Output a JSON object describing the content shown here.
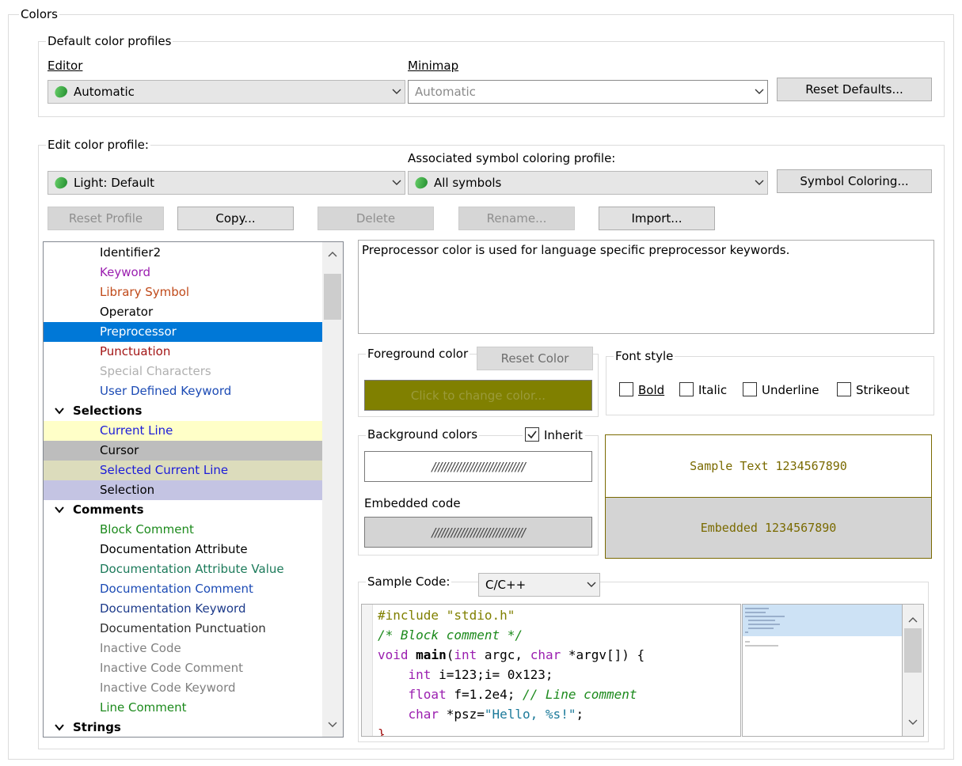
{
  "colors_group": {
    "title": "Colors"
  },
  "default_profiles": {
    "title": "Default color profiles",
    "editor_label": "Editor",
    "editor_value": "Automatic",
    "minimap_label": "Minimap",
    "minimap_value": "Automatic",
    "reset_defaults": "Reset Defaults..."
  },
  "edit_profile": {
    "title": "Edit color profile:",
    "profile_value": "Light: Default",
    "assoc_label": "Associated symbol coloring profile:",
    "assoc_value": "All symbols",
    "symbol_coloring": "Symbol Coloring...",
    "buttons": {
      "reset_profile": "Reset Profile",
      "copy": "Copy...",
      "delete": "Delete",
      "rename": "Rename...",
      "import": "Import..."
    }
  },
  "element_list": [
    {
      "label": "Identifier2",
      "color": "#000000",
      "bg": "",
      "kind": "item"
    },
    {
      "label": "Keyword",
      "color": "#9b1fb0",
      "bg": "",
      "kind": "item"
    },
    {
      "label": "Library Symbol",
      "color": "#c04a1a",
      "bg": "",
      "kind": "item"
    },
    {
      "label": "Operator",
      "color": "#000000",
      "bg": "",
      "kind": "item"
    },
    {
      "label": "Preprocessor",
      "color": "#ffffff",
      "bg": "#0078d7",
      "kind": "item"
    },
    {
      "label": "Punctuation",
      "color": "#a31515",
      "bg": "",
      "kind": "item"
    },
    {
      "label": "Special Characters",
      "color": "#b0b0b0",
      "bg": "",
      "kind": "item"
    },
    {
      "label": "User Defined Keyword",
      "color": "#1c4bb5",
      "bg": "",
      "kind": "item"
    },
    {
      "label": "Selections",
      "color": "#000000",
      "bg": "",
      "kind": "category"
    },
    {
      "label": "Current Line",
      "color": "#1c1cd9",
      "bg": "#ffffc8",
      "kind": "item"
    },
    {
      "label": "Cursor",
      "color": "#000000",
      "bg": "#bdbdbd",
      "kind": "item"
    },
    {
      "label": "Selected Current Line",
      "color": "#1c1cd9",
      "bg": "#dcdcbc",
      "kind": "item"
    },
    {
      "label": "Selection",
      "color": "#000000",
      "bg": "#c4c4e3",
      "kind": "item"
    },
    {
      "label": "Comments",
      "color": "#000000",
      "bg": "",
      "kind": "category"
    },
    {
      "label": "Block Comment",
      "color": "#1c8a1c",
      "bg": "",
      "kind": "item"
    },
    {
      "label": "Documentation Attribute",
      "color": "#000000",
      "bg": "",
      "kind": "item"
    },
    {
      "label": "Documentation Attribute Value",
      "color": "#1c7a5a",
      "bg": "",
      "kind": "item"
    },
    {
      "label": "Documentation Comment",
      "color": "#1c4bb5",
      "bg": "",
      "kind": "item"
    },
    {
      "label": "Documentation Keyword",
      "color": "#1c3a8a",
      "bg": "",
      "kind": "item"
    },
    {
      "label": "Documentation Punctuation",
      "color": "#303030",
      "bg": "",
      "kind": "item"
    },
    {
      "label": "Inactive Code",
      "color": "#808080",
      "bg": "",
      "kind": "item"
    },
    {
      "label": "Inactive Code Comment",
      "color": "#808080",
      "bg": "",
      "kind": "item"
    },
    {
      "label": "Inactive Code Keyword",
      "color": "#808080",
      "bg": "",
      "kind": "item"
    },
    {
      "label": "Line Comment",
      "color": "#1c8a1c",
      "bg": "",
      "kind": "item"
    },
    {
      "label": "Strings",
      "color": "#000000",
      "bg": "",
      "kind": "category"
    }
  ],
  "description": "Preprocessor color is used for language specific preprocessor keywords.",
  "foreground": {
    "title": "Foreground color",
    "reset_color": "Reset Color",
    "click_to_change": "Click to change color...",
    "swatch_color": "#808000"
  },
  "font_style": {
    "title": "Font style",
    "options": [
      {
        "label": "Bold",
        "checked": false
      },
      {
        "label": "Italic",
        "checked": false
      },
      {
        "label": "Underline",
        "checked": false
      },
      {
        "label": "Strikeout",
        "checked": false
      }
    ]
  },
  "background": {
    "title": "Background colors",
    "inherit_label": "Inherit",
    "inherit_checked": true,
    "pattern": "/////////////////////////////",
    "embedded_label": "Embedded code",
    "embedded_pattern": "/////////////////////////////"
  },
  "preview": {
    "sample_text": "Sample Text 1234567890",
    "embedded_text": "Embedded 1234567890",
    "text_color": "#7a6a00"
  },
  "sample_code": {
    "label": "Sample Code:",
    "language": "C/C++",
    "lines": [
      [
        {
          "t": "#include \"stdio.h\"",
          "c": "#808000"
        }
      ],
      [
        {
          "t": "/* Block comment */",
          "c": "#1c8a1c",
          "i": true
        }
      ],
      [
        {
          "t": "void ",
          "c": "#9b1fb0"
        },
        {
          "t": "main",
          "c": "#000000",
          "b": true
        },
        {
          "t": "(",
          "c": "#000000"
        },
        {
          "t": "int",
          "c": "#9b1fb0"
        },
        {
          "t": " argc, ",
          "c": "#000000"
        },
        {
          "t": "char",
          "c": "#9b1fb0"
        },
        {
          "t": " *argv[]) {",
          "c": "#000000"
        }
      ],
      [
        {
          "t": "    int",
          "c": "#9b1fb0"
        },
        {
          "t": " i=123;i= 0x123;",
          "c": "#000000"
        }
      ],
      [
        {
          "t": "    float",
          "c": "#9b1fb0"
        },
        {
          "t": " f=1.2e4; ",
          "c": "#000000"
        },
        {
          "t": "// Line comment",
          "c": "#1c8a1c",
          "i": true
        }
      ],
      [
        {
          "t": "    char",
          "c": "#9b1fb0"
        },
        {
          "t": " *psz=",
          "c": "#000000"
        },
        {
          "t": "\"Hello, %s!\"",
          "c": "#1c7a9a"
        },
        {
          "t": ";",
          "c": "#000000"
        }
      ],
      [
        {
          "t": "}",
          "c": "#a31515"
        }
      ]
    ]
  }
}
